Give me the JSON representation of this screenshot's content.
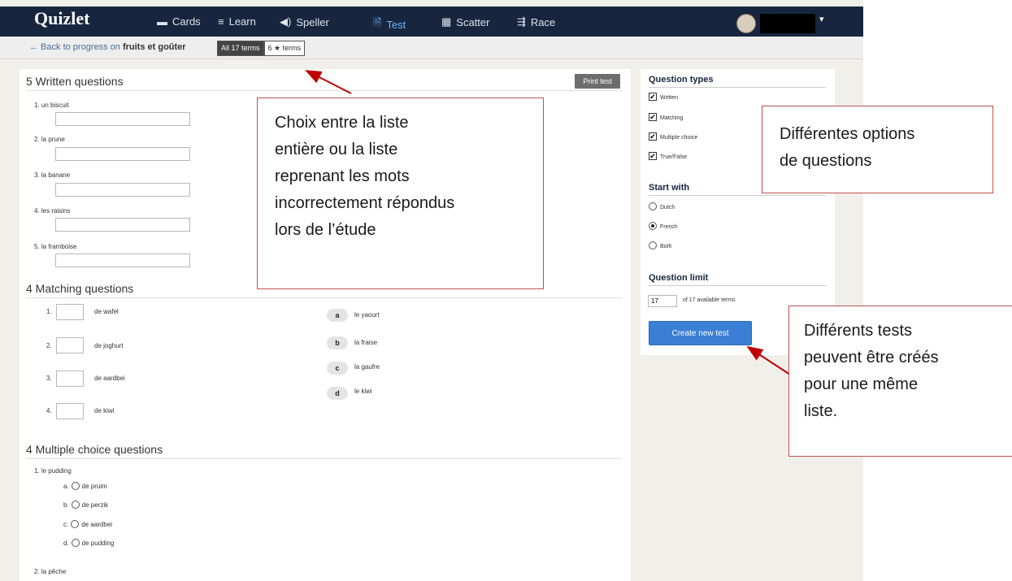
{
  "nav": {
    "logo": "Quizlet",
    "items": [
      {
        "label": "Cards",
        "icon": "cards-icon",
        "glyph": "▬"
      },
      {
        "label": "Learn",
        "icon": "learn-icon",
        "glyph": "≡"
      },
      {
        "label": "Speller",
        "icon": "speaker-icon",
        "glyph": "◀)"
      },
      {
        "label": "Test",
        "icon": "test-icon",
        "glyph": "🗎"
      },
      {
        "label": "Scatter",
        "icon": "scatter-icon",
        "glyph": "▦"
      },
      {
        "label": "Race",
        "icon": "race-icon",
        "glyph": "⇶"
      }
    ],
    "active": "Test",
    "caret": "▾"
  },
  "subbar": {
    "back_prefix": "← Back to progress on ",
    "set_name": "fruits et goûter",
    "toggle_all": "All 17 terms",
    "toggle_starred": "6 ★ terms"
  },
  "written": {
    "title": "5 Written questions",
    "print": "Print test",
    "questions": [
      "1. un biscuit",
      "2. la prune",
      "3. la banane",
      "4. les raisins",
      "5. la framboise"
    ]
  },
  "matching": {
    "title": "4 Matching questions",
    "items": [
      {
        "num": "1.",
        "term": "de wafel"
      },
      {
        "num": "2.",
        "term": "de joghurt"
      },
      {
        "num": "3.",
        "term": "de aardbei"
      },
      {
        "num": "4.",
        "term": "de kiwi"
      }
    ],
    "answers": [
      {
        "letter": "a",
        "text": "le yaourt"
      },
      {
        "letter": "b",
        "text": "la fraise"
      },
      {
        "letter": "c",
        "text": "la gaufre"
      },
      {
        "letter": "d",
        "text": "le kiwi"
      }
    ]
  },
  "multiple": {
    "title": "4 Multiple choice questions",
    "questions": [
      {
        "q": "1. le pudding",
        "options": [
          {
            "letter": "a.",
            "text": "de pruim"
          },
          {
            "letter": "b.",
            "text": "de perzik"
          },
          {
            "letter": "c.",
            "text": "de aardbei"
          },
          {
            "letter": "d.",
            "text": "de pudding"
          }
        ]
      },
      {
        "q": "2. la pêche",
        "options": []
      }
    ]
  },
  "sidebar": {
    "question_types_title": "Question types",
    "types": [
      {
        "label": "Written",
        "checked": true
      },
      {
        "label": "Matching",
        "checked": true
      },
      {
        "label": "Multiple choice",
        "checked": true
      },
      {
        "label": "True/False",
        "checked": true
      }
    ],
    "start_with_title": "Start with",
    "start_options": [
      {
        "label": "Dutch",
        "selected": false
      },
      {
        "label": "French",
        "selected": true
      },
      {
        "label": "Both",
        "selected": false
      }
    ],
    "limit_title": "Question limit",
    "limit_value": "17",
    "limit_text": "of 17 available terms",
    "create_button": "Create new test"
  },
  "callouts": {
    "list_choice": [
      "Choix entre la liste",
      "entière ou la liste",
      "reprenant les mots",
      "incorrectement répondus",
      "lors de l’étude"
    ],
    "options": [
      "Différentes options",
      "de questions"
    ],
    "tests": [
      "Différents tests",
      "peuvent être créés",
      "pour une même",
      "liste."
    ]
  },
  "colors": {
    "nav_bg": "#17263e",
    "accent": "#3a7fd5",
    "callout_border": "#c0504d",
    "arrow": "#c00000"
  }
}
